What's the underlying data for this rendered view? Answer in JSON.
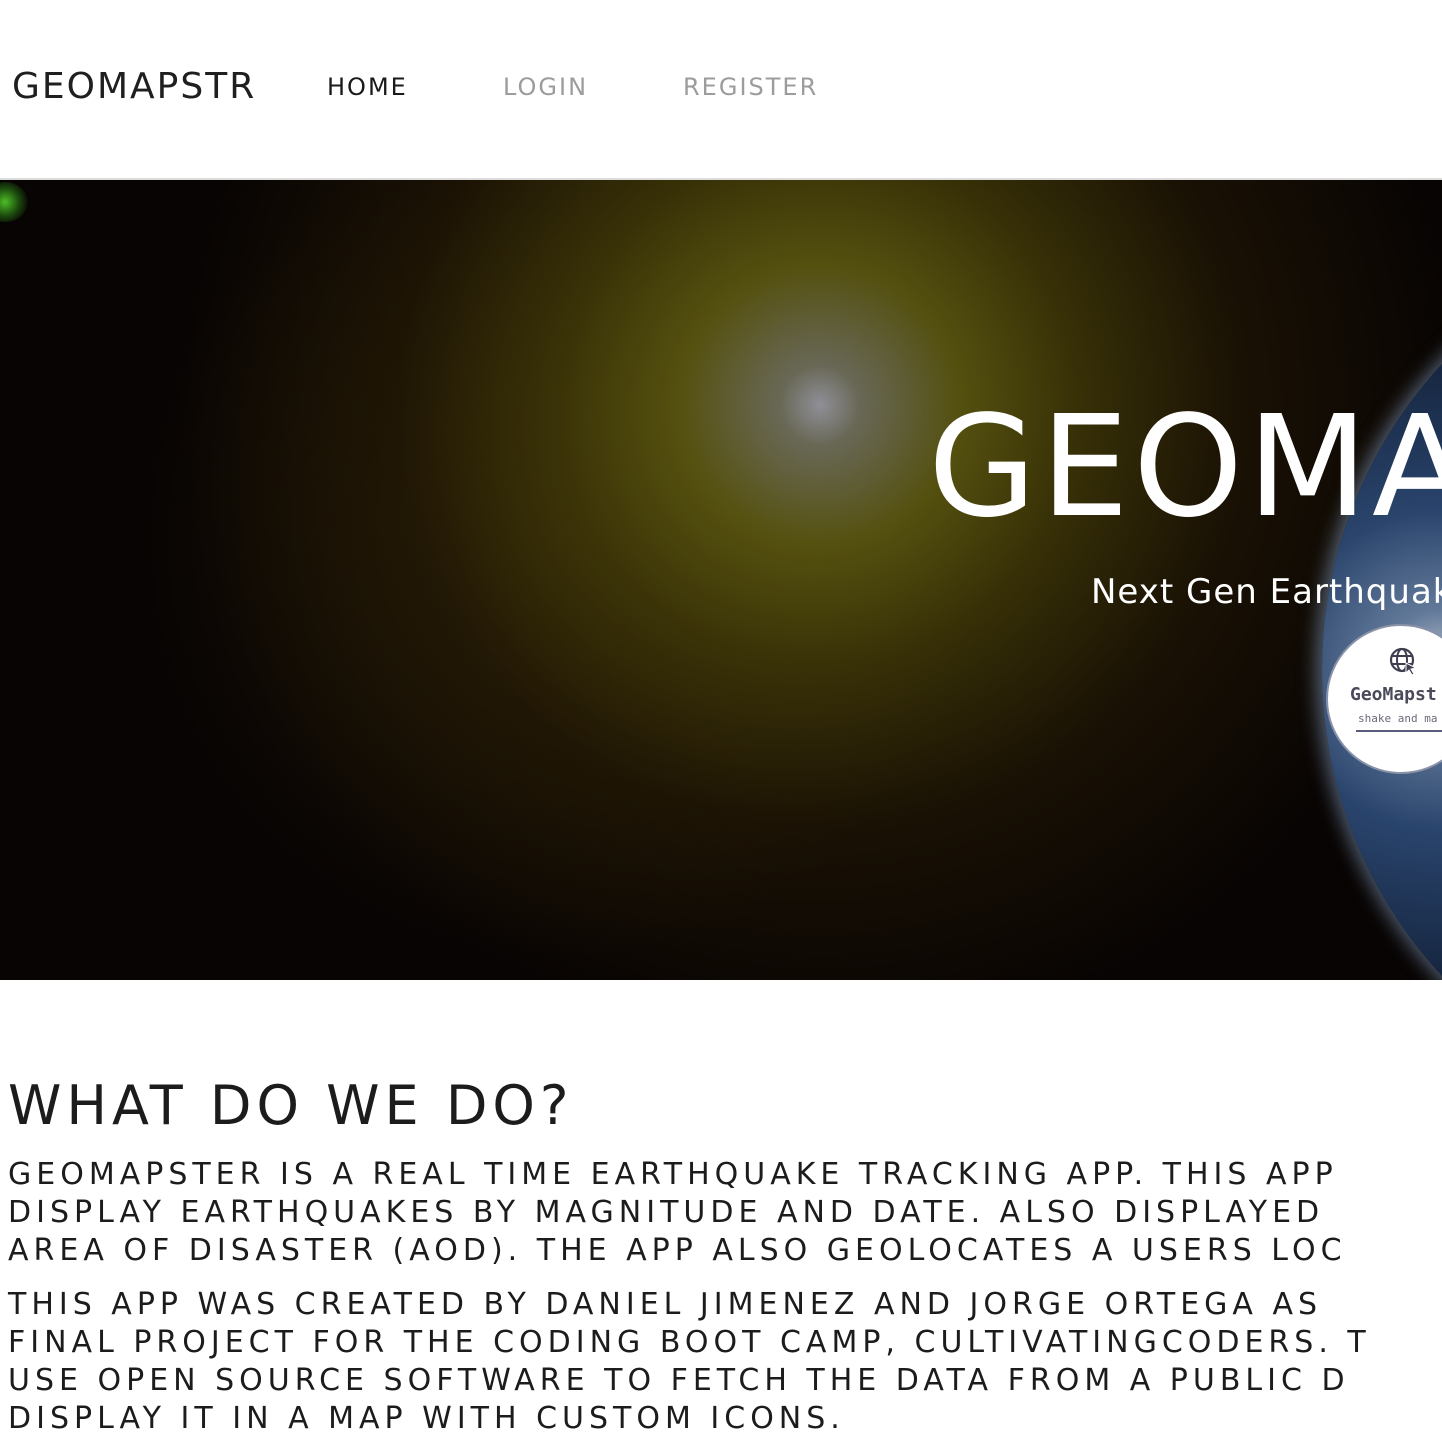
{
  "navbar": {
    "brand": "GEOMAPSTR",
    "links": [
      {
        "label": "HOME",
        "active": true
      },
      {
        "label": "LOGIN",
        "active": false
      },
      {
        "label": "REGISTER",
        "active": false
      }
    ]
  },
  "hero": {
    "title": "GEOMA",
    "subtitle": "Next Gen Earthquak",
    "logo": {
      "icon": "globe-cursor-icon",
      "name": "GeoMapst",
      "tagline": "shake and ma"
    }
  },
  "about": {
    "heading": "WHAT DO WE DO?",
    "paragraph_1": [
      "GEOMAPSTER IS A REAL TIME EARTHQUAKE TRACKING APP. THIS APP",
      "DISPLAY EARTHQUAKES BY MAGNITUDE AND DATE. ALSO DISPLAYED",
      "AREA OF DISASTER (AOD). THE APP ALSO GEOLOCATES A USERS LOC"
    ],
    "paragraph_2": [
      "THIS APP WAS CREATED BY DANIEL JIMENEZ AND JORGE ORTEGA AS",
      "FINAL PROJECT FOR THE CODING BOOT CAMP, CULTIVATINGCODERS. T",
      "USE OPEN SOURCE SOFTWARE TO FETCH THE DATA FROM A PUBLIC D",
      "DISPLAY IT IN A MAP WITH CUSTOM ICONS."
    ]
  },
  "colors": {
    "text_dark": "#1c1c1c",
    "nav_inactive": "#9c9c9c",
    "hero_text": "#ffffff"
  }
}
